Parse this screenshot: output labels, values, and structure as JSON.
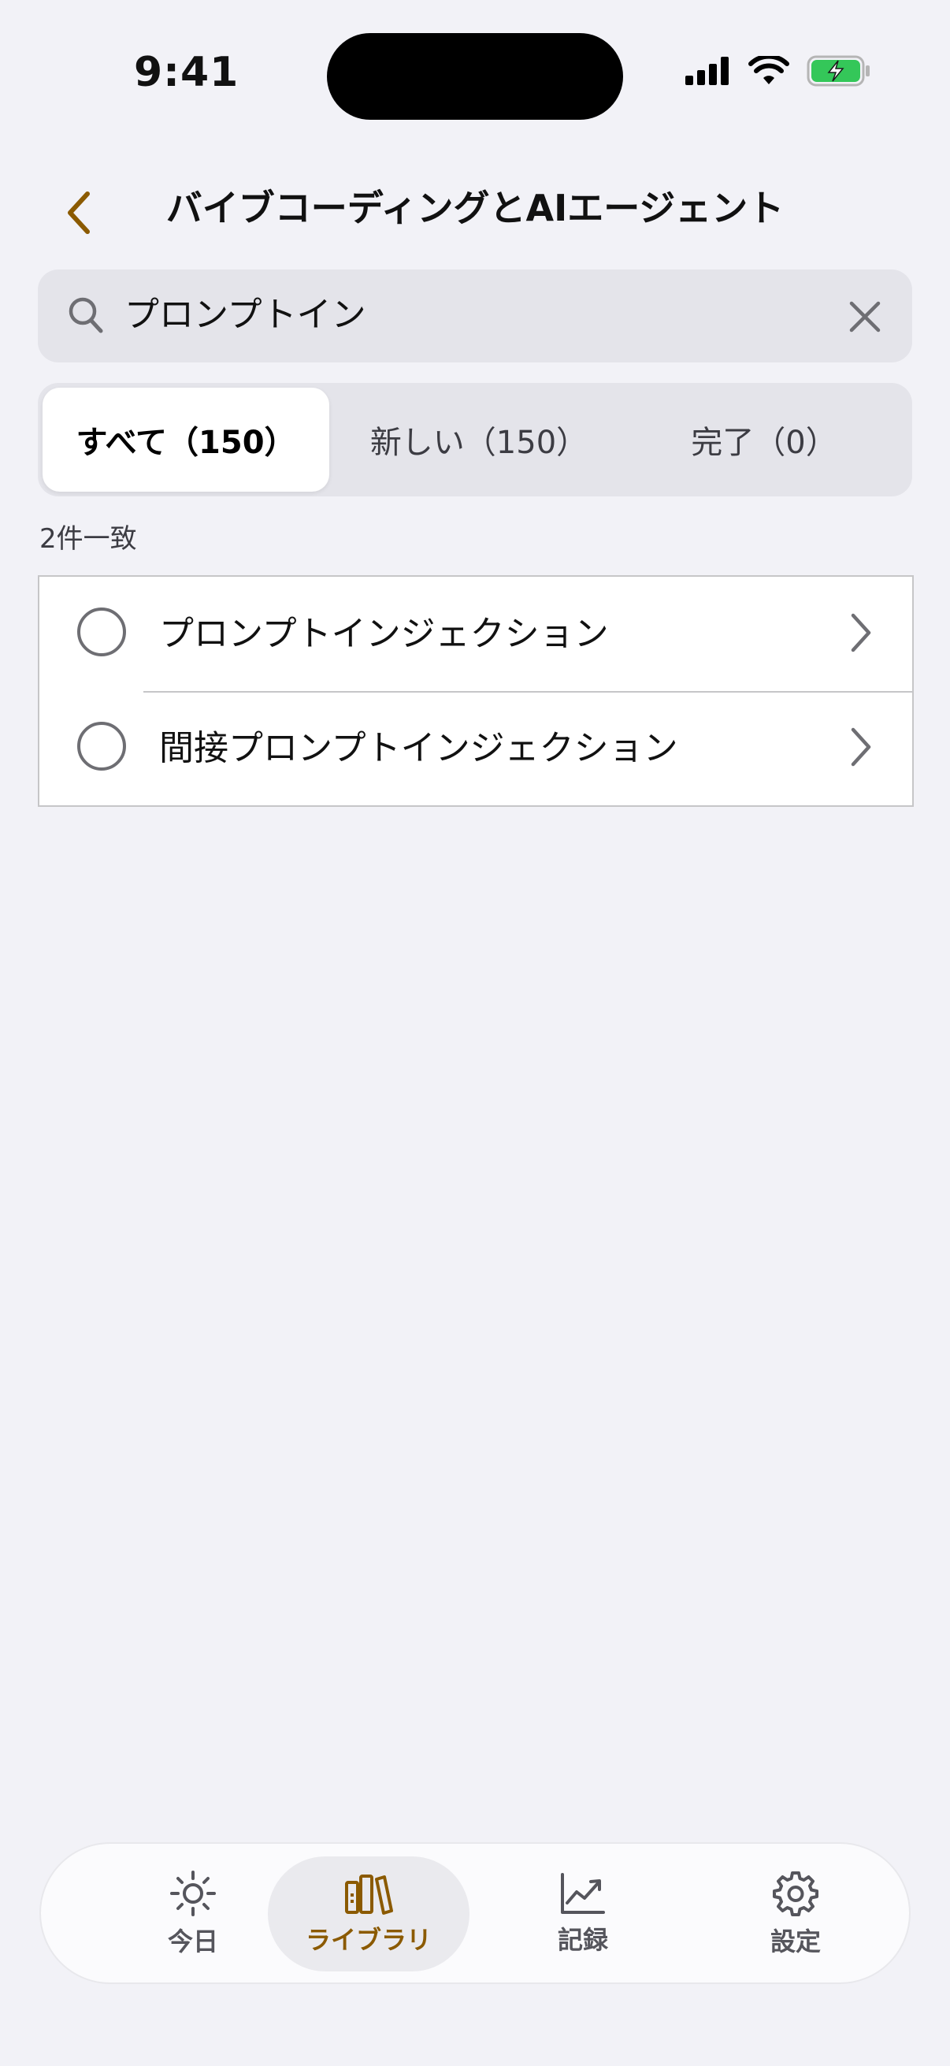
{
  "status": {
    "time": "9:41"
  },
  "nav": {
    "title": "バイブコーディングとAIエージェント"
  },
  "search": {
    "value": "プロンプトイン"
  },
  "segments": [
    {
      "label": "すべて（150）",
      "active": true
    },
    {
      "label": "新しい（150）",
      "active": false
    },
    {
      "label": "完了（0）",
      "active": false
    }
  ],
  "results": {
    "count_label": "2件一致",
    "items": [
      {
        "label": "プロンプトインジェクション"
      },
      {
        "label": "間接プロンプトインジェクション"
      }
    ]
  },
  "tabs": [
    {
      "label": "今日",
      "icon": "sun-icon"
    },
    {
      "label": "ライブラリ",
      "icon": "library-icon",
      "active": true
    },
    {
      "label": "記録",
      "icon": "chart-icon"
    },
    {
      "label": "設定",
      "icon": "gear-icon"
    }
  ],
  "colors": {
    "accent": "#8B5A00",
    "background": "#F2F2F7",
    "battery": "#34C759"
  }
}
